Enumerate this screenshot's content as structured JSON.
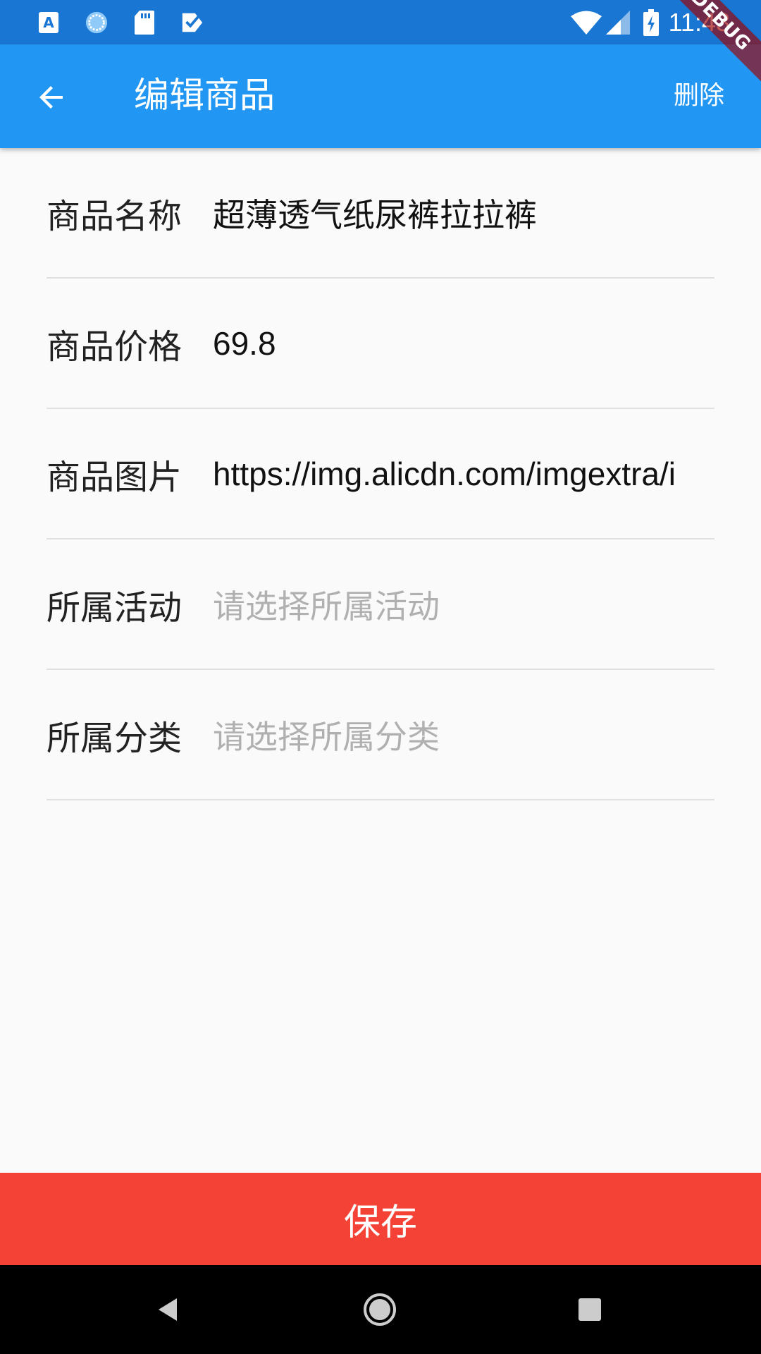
{
  "status_bar": {
    "time": "11:43",
    "icons": [
      "app-a-icon",
      "sync-circle-icon",
      "sd-card-icon",
      "check-notification-icon",
      "wifi-icon",
      "signal-icon",
      "battery-charging-icon"
    ]
  },
  "debug_banner": "DEBUG",
  "app_bar": {
    "title": "编辑商品",
    "action_label": "删除"
  },
  "form": {
    "fields": [
      {
        "label": "商品名称",
        "value": "超薄透气纸尿裤拉拉裤",
        "is_placeholder": false
      },
      {
        "label": "商品价格",
        "value": "69.8",
        "is_placeholder": false
      },
      {
        "label": "商品图片",
        "value": "https://img.alicdn.com/imgextra/i",
        "is_placeholder": false
      },
      {
        "label": "所属活动",
        "value": "请选择所属活动",
        "is_placeholder": true
      },
      {
        "label": "所属分类",
        "value": "请选择所属分类",
        "is_placeholder": true
      }
    ]
  },
  "save_button": {
    "label": "保存"
  },
  "colors": {
    "status_bar": "#1976d2",
    "app_bar": "#2196f3",
    "save_button": "#f44336",
    "placeholder": "#b0b0b0"
  }
}
